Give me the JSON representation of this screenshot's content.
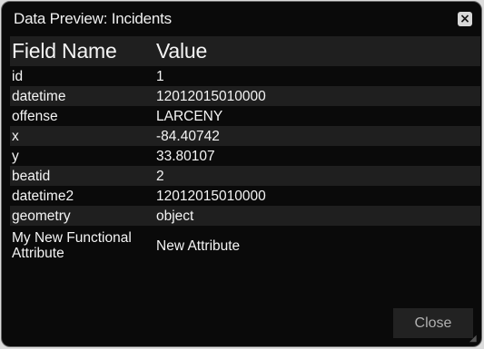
{
  "dialog": {
    "title": "Data Preview: Incidents",
    "close_icon": "close-icon",
    "close_button_label": "Close",
    "resize_icon": "resize-handle-icon"
  },
  "table": {
    "headers": [
      "Field Name",
      "Value"
    ],
    "rows": [
      {
        "field": "id",
        "value": "1"
      },
      {
        "field": "datetime",
        "value": "12012015010000"
      },
      {
        "field": "offense",
        "value": "LARCENY"
      },
      {
        "field": "x",
        "value": "-84.40742"
      },
      {
        "field": "y",
        "value": "33.80107"
      },
      {
        "field": "beatid",
        "value": "2"
      },
      {
        "field": "datetime2",
        "value": "12012015010000"
      },
      {
        "field": "geometry",
        "value": "object"
      },
      {
        "field": "My New Functional Attribute",
        "value": "New Attribute"
      }
    ]
  },
  "colors": {
    "background": "#0a0a0a",
    "row_shade": "#1f1f1f",
    "text": "#f4f4f4",
    "button_text": "#b0b0b0"
  }
}
